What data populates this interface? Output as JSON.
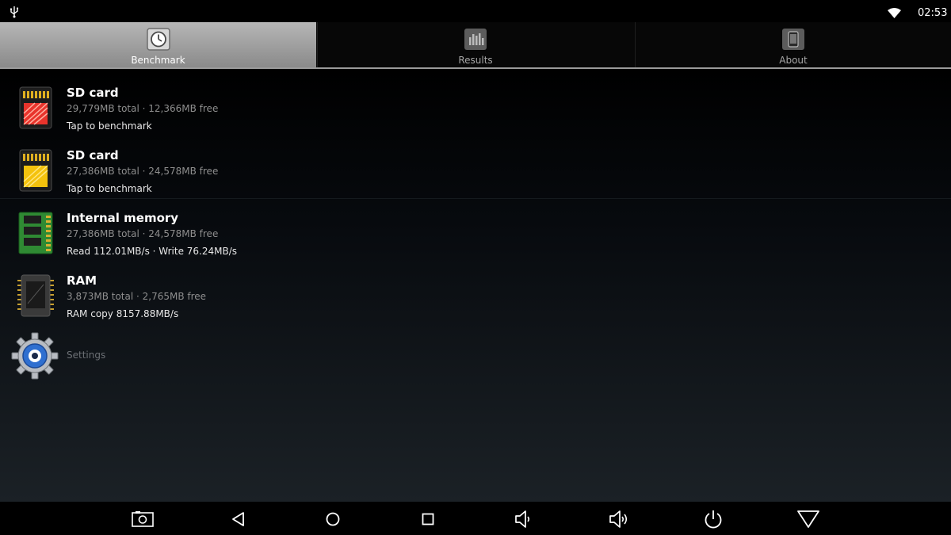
{
  "status_bar": {
    "time": "02:53",
    "icons": [
      "usb-icon",
      "wifi-icon"
    ]
  },
  "tabs": [
    {
      "label": "Benchmark",
      "icon": "clock-icon",
      "active": true
    },
    {
      "label": "Results",
      "icon": "bar-chart-icon",
      "active": false
    },
    {
      "label": "About",
      "icon": "phone-icon",
      "active": false
    }
  ],
  "items": [
    {
      "title": "SD card",
      "subtitle": "29,779MB total · 12,366MB free",
      "status": "Tap to benchmark",
      "icon": "sd-card-red-icon",
      "icon_color": "#e8342c"
    },
    {
      "title": "SD card",
      "subtitle": "27,386MB total · 24,578MB free",
      "status": "Tap to benchmark",
      "icon": "sd-card-yellow-icon",
      "icon_color": "#f4c20d"
    },
    {
      "title": "Internal memory",
      "subtitle": "27,386MB total · 24,578MB free",
      "status": "Read 112.01MB/s · Write 76.24MB/s",
      "icon": "memory-chip-icon",
      "icon_color": "#3c9a3c"
    },
    {
      "title": "RAM",
      "subtitle": "3,873MB total · 2,765MB free",
      "status": "RAM copy 8157.88MB/s",
      "icon": "ram-chip-icon",
      "icon_color": "#3a3a3a"
    }
  ],
  "settings": {
    "label": "Settings",
    "icon": "gear-icon"
  },
  "nav_bar": {
    "buttons": [
      "screenshot-icon",
      "back-icon",
      "home-icon",
      "recents-icon",
      "volume-down-icon",
      "volume-up-icon",
      "power-icon",
      "menu-down-icon"
    ]
  },
  "colors": {
    "accent_tab": "#a0a0a0",
    "background": "#000000",
    "secondary_text": "#8e8e8e"
  }
}
